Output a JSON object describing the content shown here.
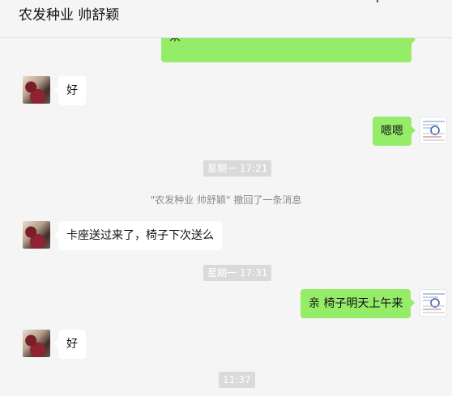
{
  "header": {
    "title": "农发种业 帅舒颖",
    "icons": [
      "add-icon",
      "more-icon"
    ]
  },
  "messages": [
    {
      "sender": "me",
      "text": "来",
      "partial": true
    },
    {
      "sender": "them",
      "text": "好"
    },
    {
      "sender": "me",
      "text": "嗯嗯"
    },
    {
      "type": "time",
      "text": "星期一 17:21"
    },
    {
      "type": "notice",
      "text": "\"农发种业 帅舒颖\" 撤回了一条消息"
    },
    {
      "sender": "them",
      "text": "卡座送过来了，椅子下次送么"
    },
    {
      "type": "time",
      "text": "星期一 17:31"
    },
    {
      "sender": "me",
      "text": "亲 椅子明天上午来"
    },
    {
      "sender": "them",
      "text": "好"
    },
    {
      "type": "time",
      "text": "11:37"
    }
  ],
  "colors": {
    "me_bubble": "#95ec69",
    "them_bubble": "#ffffff",
    "background": "#f5f5f5"
  }
}
